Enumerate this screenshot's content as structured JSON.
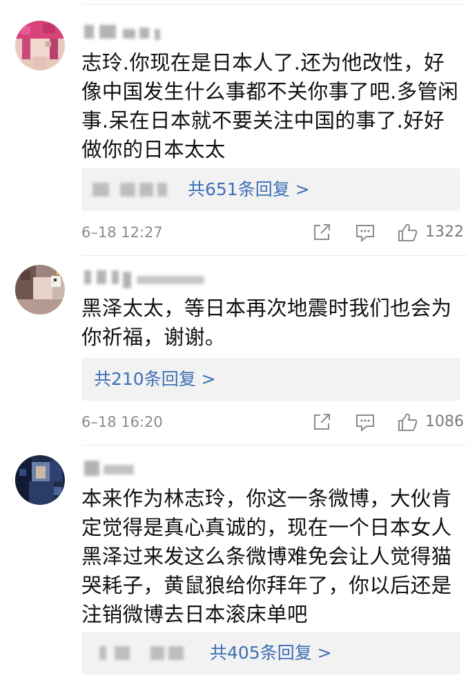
{
  "comments": [
    {
      "text": "志玲.你现在是日本人了.还为他改性，好像中国发生什么事都不关你事了吧.多管闲事.呆在日本就不要关注中国的事了.好好做你的日本太太",
      "reply_link": "共651条回复 >",
      "timestamp": "6–18 12:27",
      "like_count": "1322"
    },
    {
      "text": "黑泽太太，等日本再次地震时我们也会为你祈福，谢谢。",
      "reply_link": "共210条回复 >",
      "timestamp": "6–18 16:20",
      "like_count": "1086"
    },
    {
      "text": "本来作为林志玲，你这一条微博，大伙肯定觉得是真心真诚的，现在一个日本女人黑泽过来发这么条微博难免会让人觉得猫哭耗子，黄鼠狼给你拜年了，你以后还是注销微博去日本滚床单吧",
      "reply_link": "共405条回复 >"
    }
  ],
  "icons": {
    "share": "share-icon",
    "comment": "comment-icon",
    "like": "thumbs-up-icon"
  },
  "colors": {
    "link": "#3d6fb4",
    "reply_bg": "#f2f2f2",
    "meta": "#8a8a8a"
  }
}
